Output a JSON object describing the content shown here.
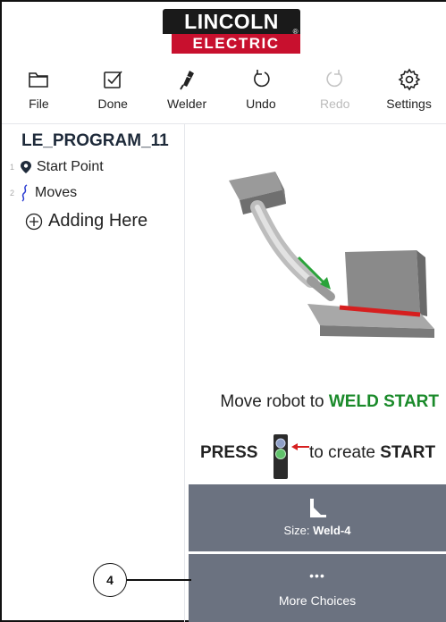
{
  "header": {
    "logo_top": "LINCOLN",
    "logo_reg": "®",
    "logo_bottom": "ELECTRIC",
    "brand_red": "#c8102e"
  },
  "toolbar": {
    "items": [
      {
        "label": "File",
        "icon": "folder-icon",
        "enabled": true
      },
      {
        "label": "Done",
        "icon": "checkbox-icon",
        "enabled": true
      },
      {
        "label": "Welder",
        "icon": "welding-torch-icon",
        "enabled": true
      },
      {
        "label": "Undo",
        "icon": "undo-icon",
        "enabled": true
      },
      {
        "label": "Redo",
        "icon": "redo-icon",
        "enabled": false
      },
      {
        "label": "Settings",
        "icon": "gear-icon",
        "enabled": true
      }
    ]
  },
  "program": {
    "title": "LE_PROGRAM_11",
    "steps": [
      {
        "num": "1",
        "label": "Start Point",
        "icon": "location-pin-icon"
      },
      {
        "num": "2",
        "label": "Moves",
        "icon": "squiggle-path-icon"
      }
    ],
    "add_label": "Adding Here"
  },
  "instructions": {
    "line1_prefix": "Move robot to ",
    "line1_highlight": "WELD START",
    "press": "PRESS",
    "line2_prefix": "to create ",
    "line2_bold": "START",
    "highlight_color": "#1a8a2a"
  },
  "choices": {
    "size_label": "Size:",
    "size_value": "Weld-4",
    "more_icon_text": "•••",
    "more_label": "More Choices"
  },
  "callout": {
    "number": "4"
  }
}
